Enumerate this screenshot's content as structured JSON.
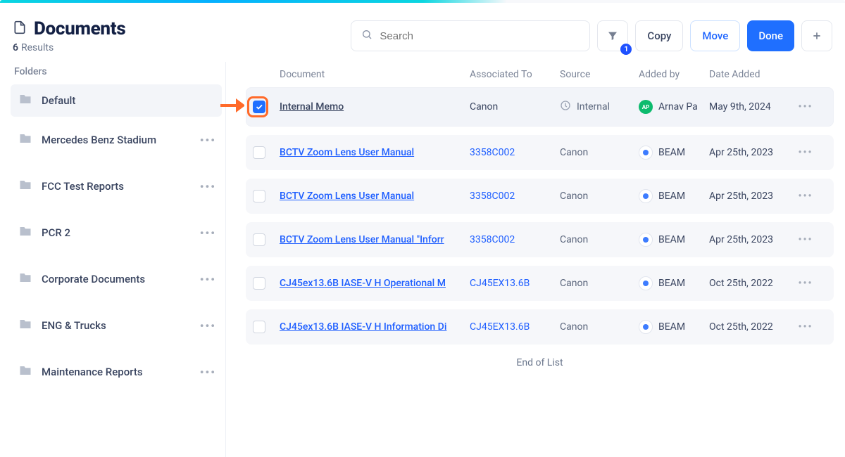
{
  "header": {
    "title": "Documents",
    "result_count": "6",
    "result_label": "Results",
    "search_placeholder": "Search",
    "filter_badge": "1",
    "copy_label": "Copy",
    "move_label": "Move",
    "done_label": "Done",
    "add_label": "+"
  },
  "sidebar": {
    "title": "Folders",
    "items": [
      {
        "label": "Default",
        "active": true
      },
      {
        "label": "Mercedes Benz Stadium"
      },
      {
        "label": "FCC Test Reports"
      },
      {
        "label": "PCR 2"
      },
      {
        "label": "Corporate Documents"
      },
      {
        "label": "ENG & Trucks"
      },
      {
        "label": "Maintenance Reports"
      }
    ]
  },
  "table": {
    "headers": {
      "document": "Document",
      "associated": "Associated To",
      "source": "Source",
      "added_by": "Added by",
      "date_added": "Date Added"
    },
    "end_label": "End of List",
    "rows": [
      {
        "checked": true,
        "highlighted": true,
        "name": "Internal Memo",
        "assoc": "Canon",
        "assoc_link": false,
        "source": "Internal",
        "source_kind": "internal",
        "added_by": "Arnav Pa",
        "added_by_kind": "ap",
        "date": "May 9th, 2024"
      },
      {
        "name": "BCTV Zoom Lens User Manual",
        "assoc": "3358C002",
        "assoc_link": true,
        "source": "Canon",
        "added_by": "BEAM",
        "added_by_kind": "beam",
        "date": "Apr 25th, 2023"
      },
      {
        "name": "BCTV Zoom Lens User Manual",
        "assoc": "3358C002",
        "assoc_link": true,
        "source": "Canon",
        "added_by": "BEAM",
        "added_by_kind": "beam",
        "date": "Apr 25th, 2023"
      },
      {
        "name": "BCTV Zoom Lens User Manual \"Inforr",
        "assoc": "3358C002",
        "assoc_link": true,
        "source": "Canon",
        "added_by": "BEAM",
        "added_by_kind": "beam",
        "date": "Apr 25th, 2023"
      },
      {
        "name": "CJ45ex13.6B IASE-V H Operational M",
        "assoc": "CJ45EX13.6B",
        "assoc_link": true,
        "source": "Canon",
        "added_by": "BEAM",
        "added_by_kind": "beam",
        "date": "Oct 25th, 2022"
      },
      {
        "name": "CJ45ex13.6B IASE-V H Information Di",
        "assoc": "CJ45EX13.6B",
        "assoc_link": true,
        "source": "Canon",
        "added_by": "BEAM",
        "added_by_kind": "beam",
        "date": "Oct 25th, 2022"
      }
    ]
  }
}
